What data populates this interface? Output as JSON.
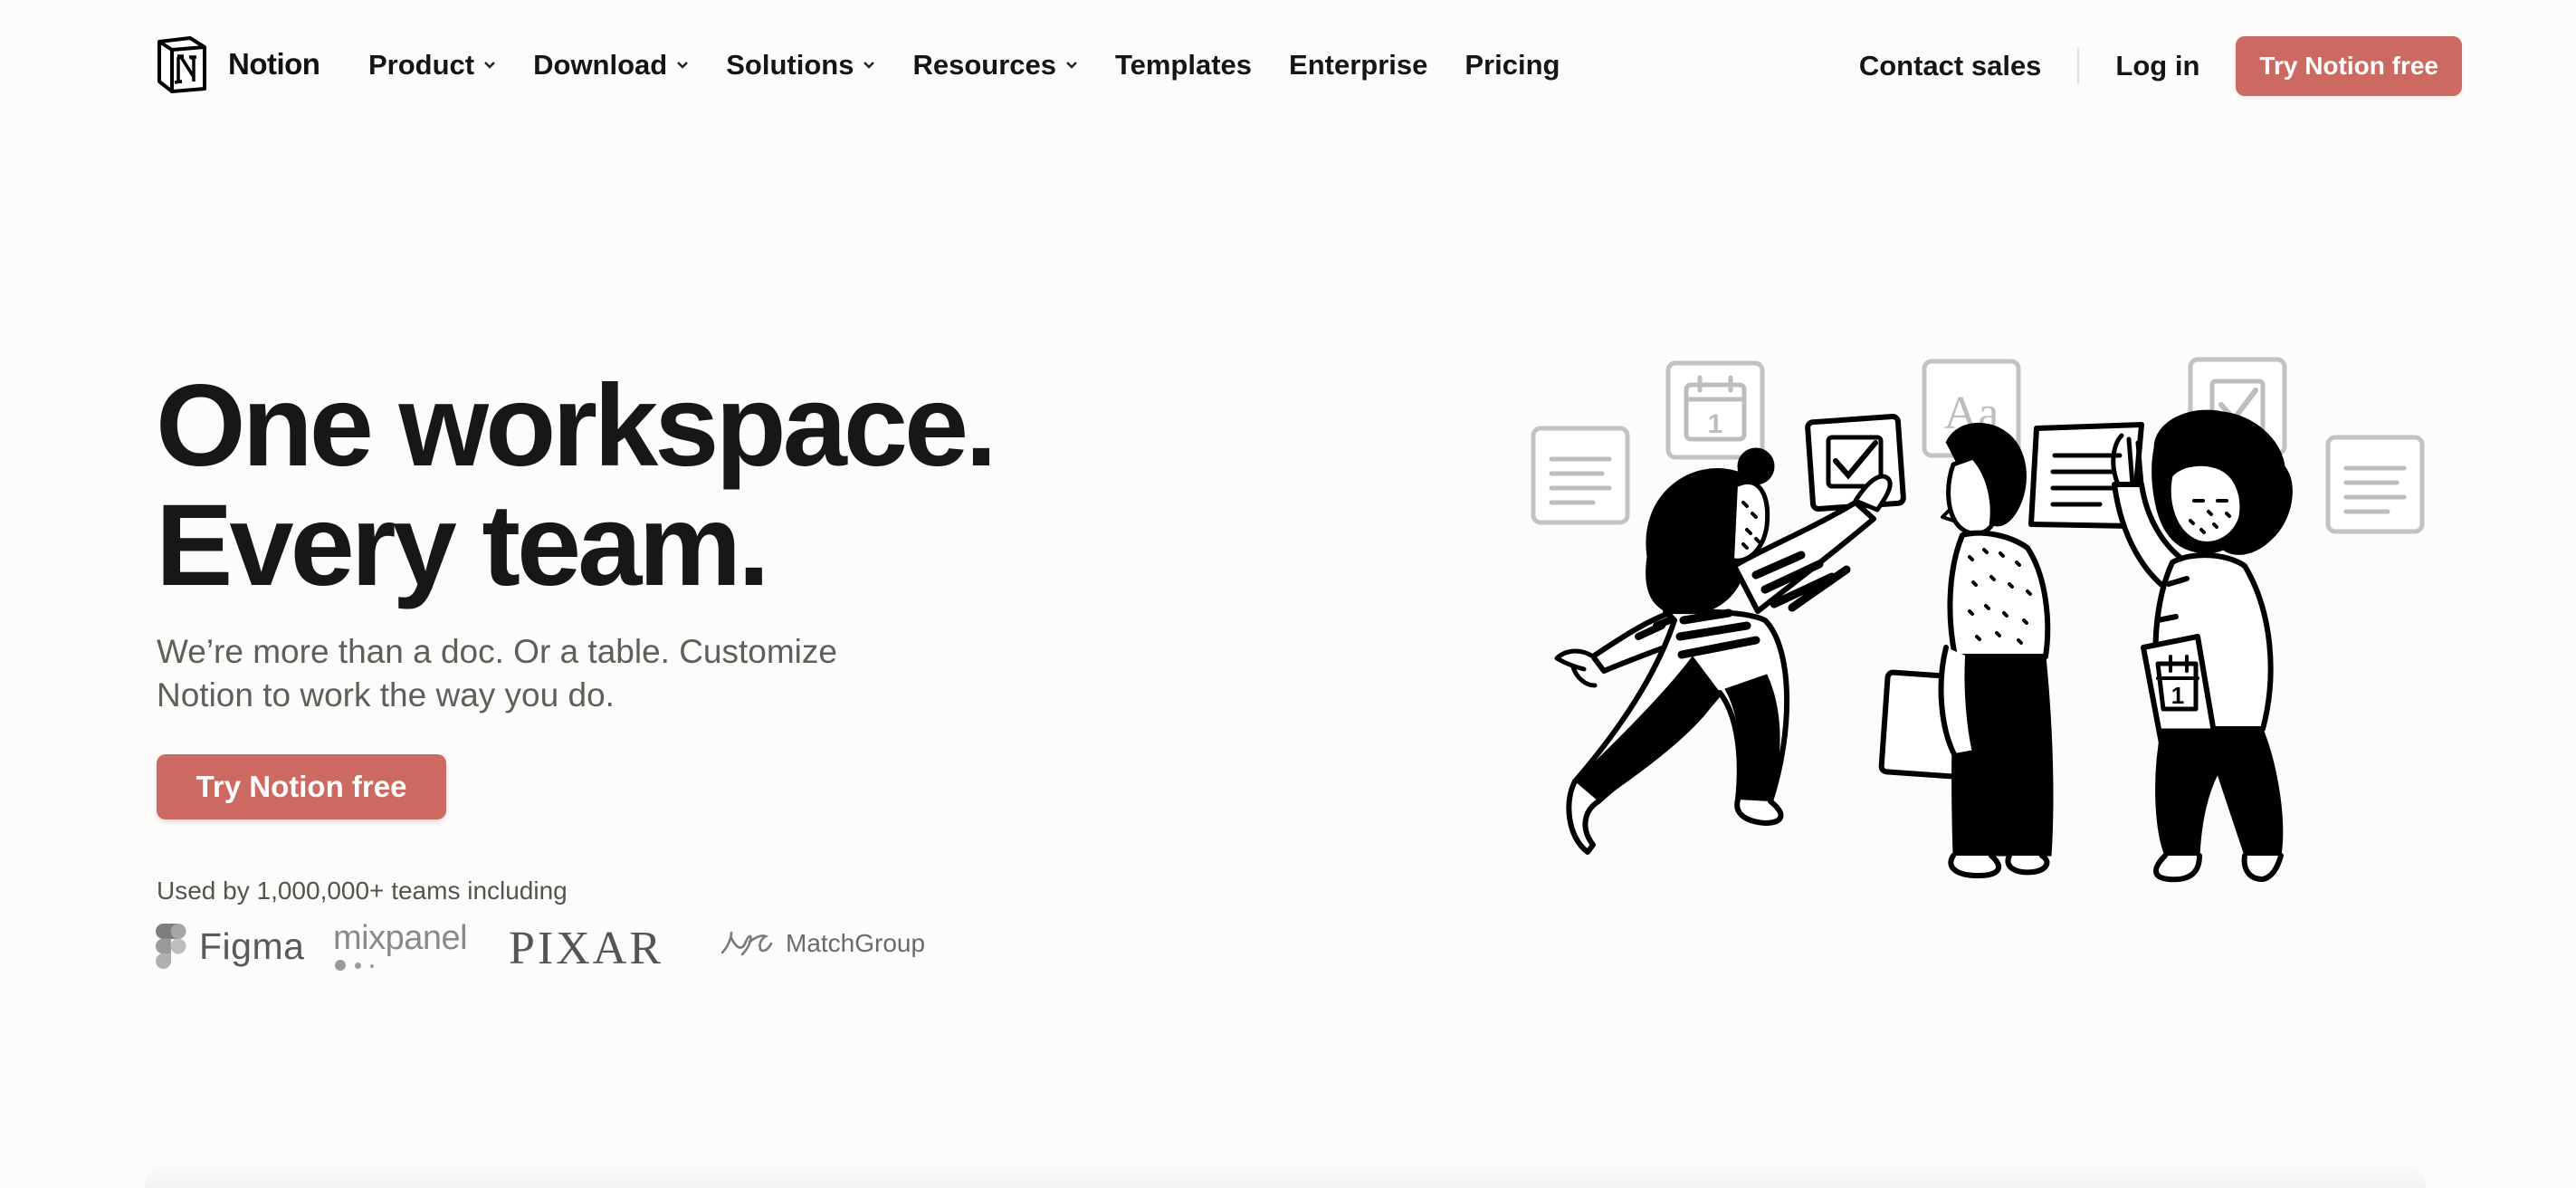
{
  "nav": {
    "logo_text": "Notion",
    "menu": [
      {
        "label": "Product",
        "has_dropdown": true
      },
      {
        "label": "Download",
        "has_dropdown": true
      },
      {
        "label": "Solutions",
        "has_dropdown": true
      },
      {
        "label": "Resources",
        "has_dropdown": true
      },
      {
        "label": "Templates",
        "has_dropdown": false
      },
      {
        "label": "Enterprise",
        "has_dropdown": false
      },
      {
        "label": "Pricing",
        "has_dropdown": false
      }
    ],
    "contact_sales": "Contact sales",
    "log_in": "Log in",
    "cta": "Try Notion free"
  },
  "hero": {
    "title_line1": "One workspace.",
    "title_line2": "Every team.",
    "subtitle": "We’re more than a doc. Or a table. Customize Notion to work the way you do.",
    "cta": "Try Notion free",
    "used_by": "Used by 1,000,000+ teams including",
    "logos": [
      {
        "name": "Figma",
        "icon": "figma-logo"
      },
      {
        "name": "mixpanel",
        "icon": "mixpanel-logo"
      },
      {
        "name": "PIXAR",
        "icon": "pixar-logo"
      },
      {
        "name": "MatchGroup",
        "icon": "matchgroup-logo"
      }
    ]
  },
  "illustration": {
    "icon": "team-collaboration-illustration",
    "floating_icons": [
      "document-icon",
      "calendar-icon",
      "checkbox-icon",
      "text-style-icon",
      "document-icon",
      "checkbox-icon",
      "document-icon"
    ],
    "text_icon_label": "Aa",
    "calendar_number": "1"
  },
  "colors": {
    "accent": "#cc6a62",
    "background": "#fdfcfb",
    "text": "#151515",
    "muted_text": "#5f5e5b"
  }
}
